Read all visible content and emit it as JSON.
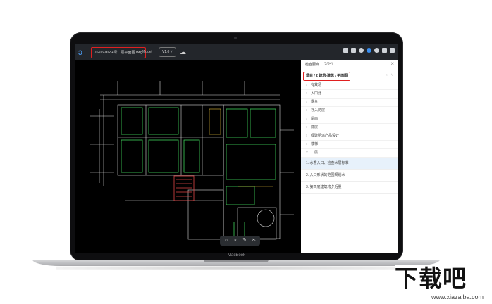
{
  "app": {
    "file_name": "JS-06-002-4号二层平面图.dwg",
    "mode_label": "Model",
    "version_label": "V1.0 ˅"
  },
  "panel": {
    "title": "检查要点",
    "count": "(3/94)",
    "breadcrumb": "项目 / 2 建筑-建筑 / 平面图",
    "controls": "‹  –  ˅",
    "tree_items": [
      "有效场",
      "入口处",
      "露台",
      "存入防层",
      "屋面",
      "底层",
      "绿建明派产品设计",
      "楼梯",
      "二层"
    ],
    "issues": [
      "1. 水香入口、检查水层标准",
      "2. 入口形状的范围规划水",
      "3. 第四底建筑垮夕后量"
    ]
  },
  "bottom_toolbar": [
    "⌂",
    "⌕",
    "✎",
    "✂"
  ],
  "device_brand": "MacBook",
  "watermark": {
    "main": "下载吧",
    "url": "www.xiazaiba.com"
  },
  "colors": {
    "highlight": "#e02020",
    "accent": "#3a8ff0",
    "cad_lines": "#e8e8e8",
    "cad_green": "#3fd35c"
  }
}
